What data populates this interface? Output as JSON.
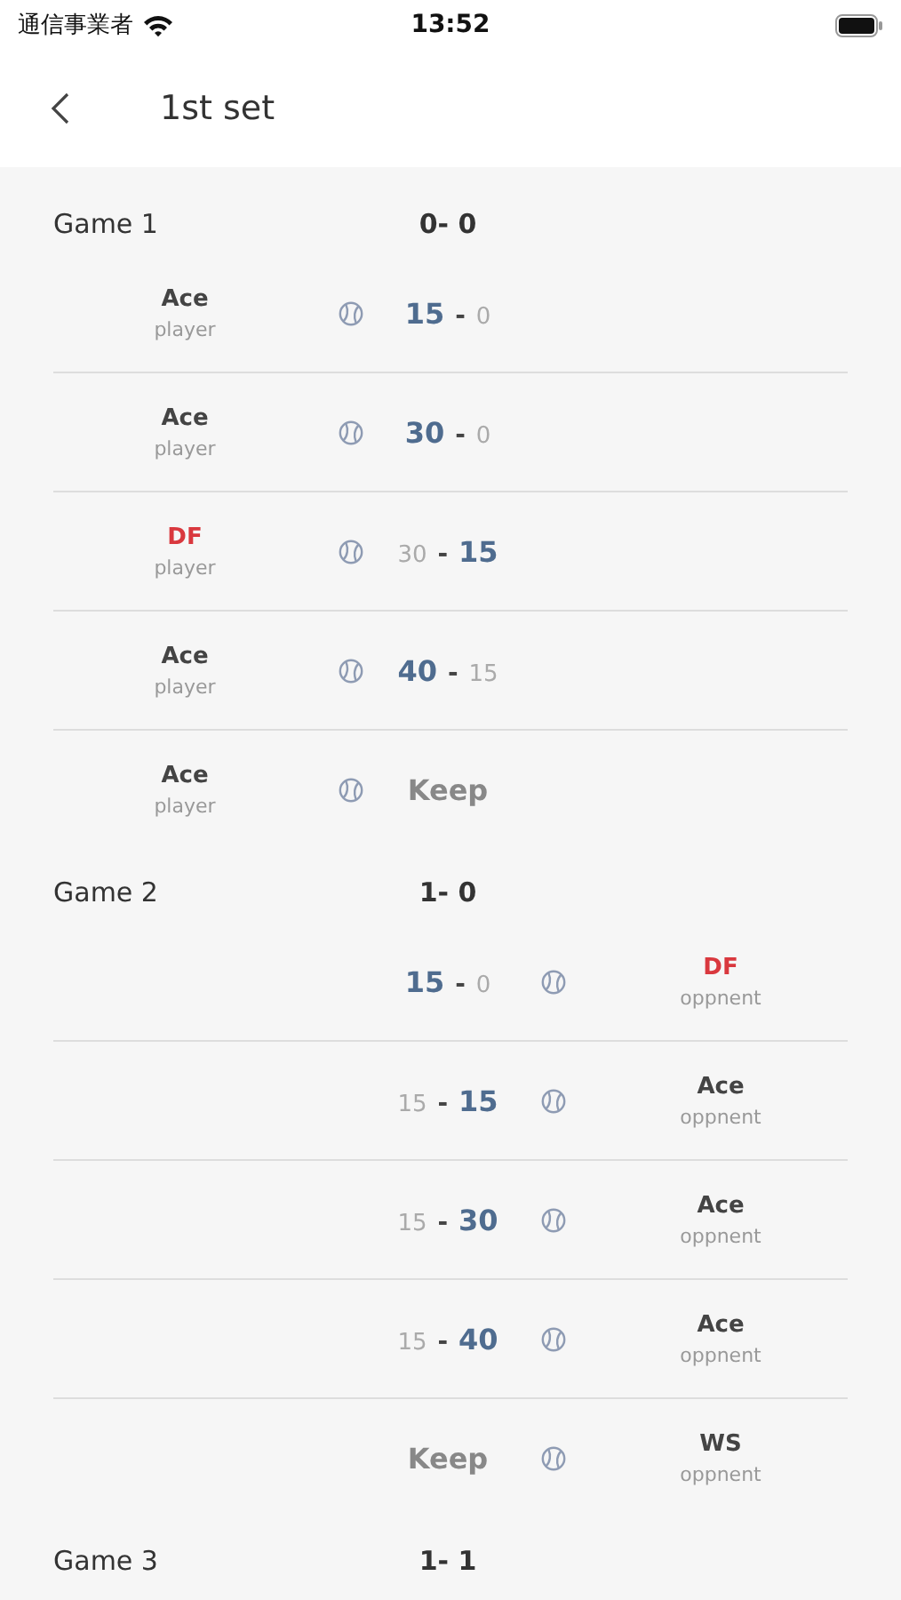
{
  "status_bar": {
    "carrier": "通信事業者",
    "time": "13:52"
  },
  "nav": {
    "title": "1st set"
  },
  "games": [
    {
      "title": "Game 1",
      "score": "0- 0",
      "points": [
        {
          "kind": "player",
          "shot": "Ace",
          "fault": false,
          "who": "player",
          "score": {
            "kind": "points",
            "left": {
              "text": "15",
              "highlighted": true
            },
            "sep": "-",
            "right": {
              "text": "0",
              "highlighted": false
            }
          }
        },
        {
          "kind": "player",
          "shot": "Ace",
          "fault": false,
          "who": "player",
          "score": {
            "kind": "points",
            "left": {
              "text": "30",
              "highlighted": true
            },
            "sep": "-",
            "right": {
              "text": "0",
              "highlighted": false
            }
          }
        },
        {
          "kind": "player",
          "shot": "DF",
          "fault": true,
          "who": "player",
          "score": {
            "kind": "points",
            "left": {
              "text": "30",
              "highlighted": false
            },
            "sep": "-",
            "right": {
              "text": "15",
              "highlighted": true
            }
          }
        },
        {
          "kind": "player",
          "shot": "Ace",
          "fault": false,
          "who": "player",
          "score": {
            "kind": "points",
            "left": {
              "text": "40",
              "highlighted": true
            },
            "sep": "-",
            "right": {
              "text": "15",
              "highlighted": false
            }
          }
        },
        {
          "kind": "player",
          "shot": "Ace",
          "fault": false,
          "who": "player",
          "score": {
            "kind": "keep",
            "text": "Keep"
          }
        }
      ]
    },
    {
      "title": "Game 2",
      "score": "1- 0",
      "points": [
        {
          "kind": "opponent",
          "shot": "DF",
          "fault": true,
          "who": "oppnent",
          "score": {
            "kind": "points",
            "left": {
              "text": "15",
              "highlighted": true
            },
            "sep": "-",
            "right": {
              "text": "0",
              "highlighted": false
            }
          }
        },
        {
          "kind": "opponent",
          "shot": "Ace",
          "fault": false,
          "who": "oppnent",
          "score": {
            "kind": "points",
            "left": {
              "text": "15",
              "highlighted": false
            },
            "sep": "-",
            "right": {
              "text": "15",
              "highlighted": true
            }
          }
        },
        {
          "kind": "opponent",
          "shot": "Ace",
          "fault": false,
          "who": "oppnent",
          "score": {
            "kind": "points",
            "left": {
              "text": "15",
              "highlighted": false
            },
            "sep": "-",
            "right": {
              "text": "30",
              "highlighted": true
            }
          }
        },
        {
          "kind": "opponent",
          "shot": "Ace",
          "fault": false,
          "who": "oppnent",
          "score": {
            "kind": "points",
            "left": {
              "text": "15",
              "highlighted": false
            },
            "sep": "-",
            "right": {
              "text": "40",
              "highlighted": true
            }
          }
        },
        {
          "kind": "opponent",
          "shot": "WS",
          "fault": false,
          "who": "oppnent",
          "score": {
            "kind": "keep",
            "text": "Keep"
          }
        }
      ]
    },
    {
      "title": "Game 3",
      "score": "1- 1"
    }
  ]
}
